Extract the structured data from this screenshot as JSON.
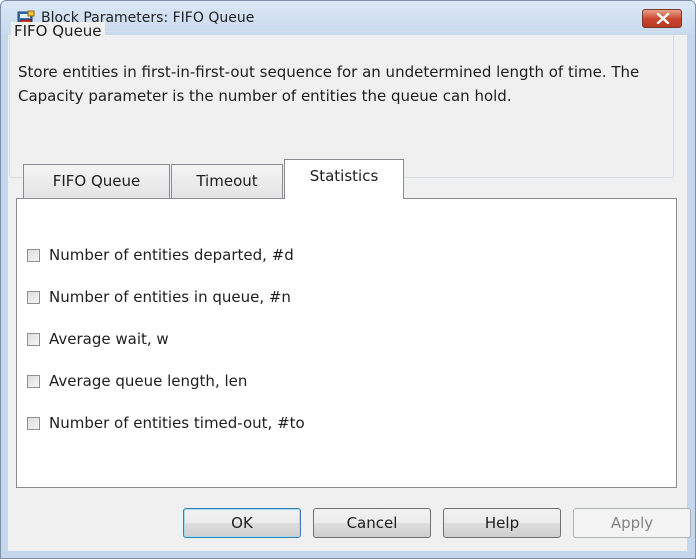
{
  "window": {
    "title": "Block Parameters: FIFO Queue",
    "close_icon": "close-x-icon",
    "app_icon": "simulink-block-icon"
  },
  "group": {
    "legend": "FIFO Queue",
    "description": "Store entities in first-in-first-out sequence for an undetermined length of time. The Capacity parameter is the number of entities the queue can hold."
  },
  "tabs": [
    {
      "label": "FIFO Queue",
      "active": false
    },
    {
      "label": "Timeout",
      "active": false
    },
    {
      "label": "Statistics",
      "active": true
    }
  ],
  "statistics": {
    "options": [
      {
        "label": "Number of entities departed, #d",
        "checked": false
      },
      {
        "label": "Number of entities in queue, #n",
        "checked": false
      },
      {
        "label": "Average wait, w",
        "checked": false
      },
      {
        "label": "Average queue length, len",
        "checked": false
      },
      {
        "label": "Number of entities timed-out, #to",
        "checked": false
      }
    ]
  },
  "buttons": {
    "ok": "OK",
    "cancel": "Cancel",
    "help": "Help",
    "apply": "Apply"
  },
  "colors": {
    "titlebar": "#c8daee",
    "client_bg": "#f0f0f0",
    "close_button": "#c8452c"
  }
}
